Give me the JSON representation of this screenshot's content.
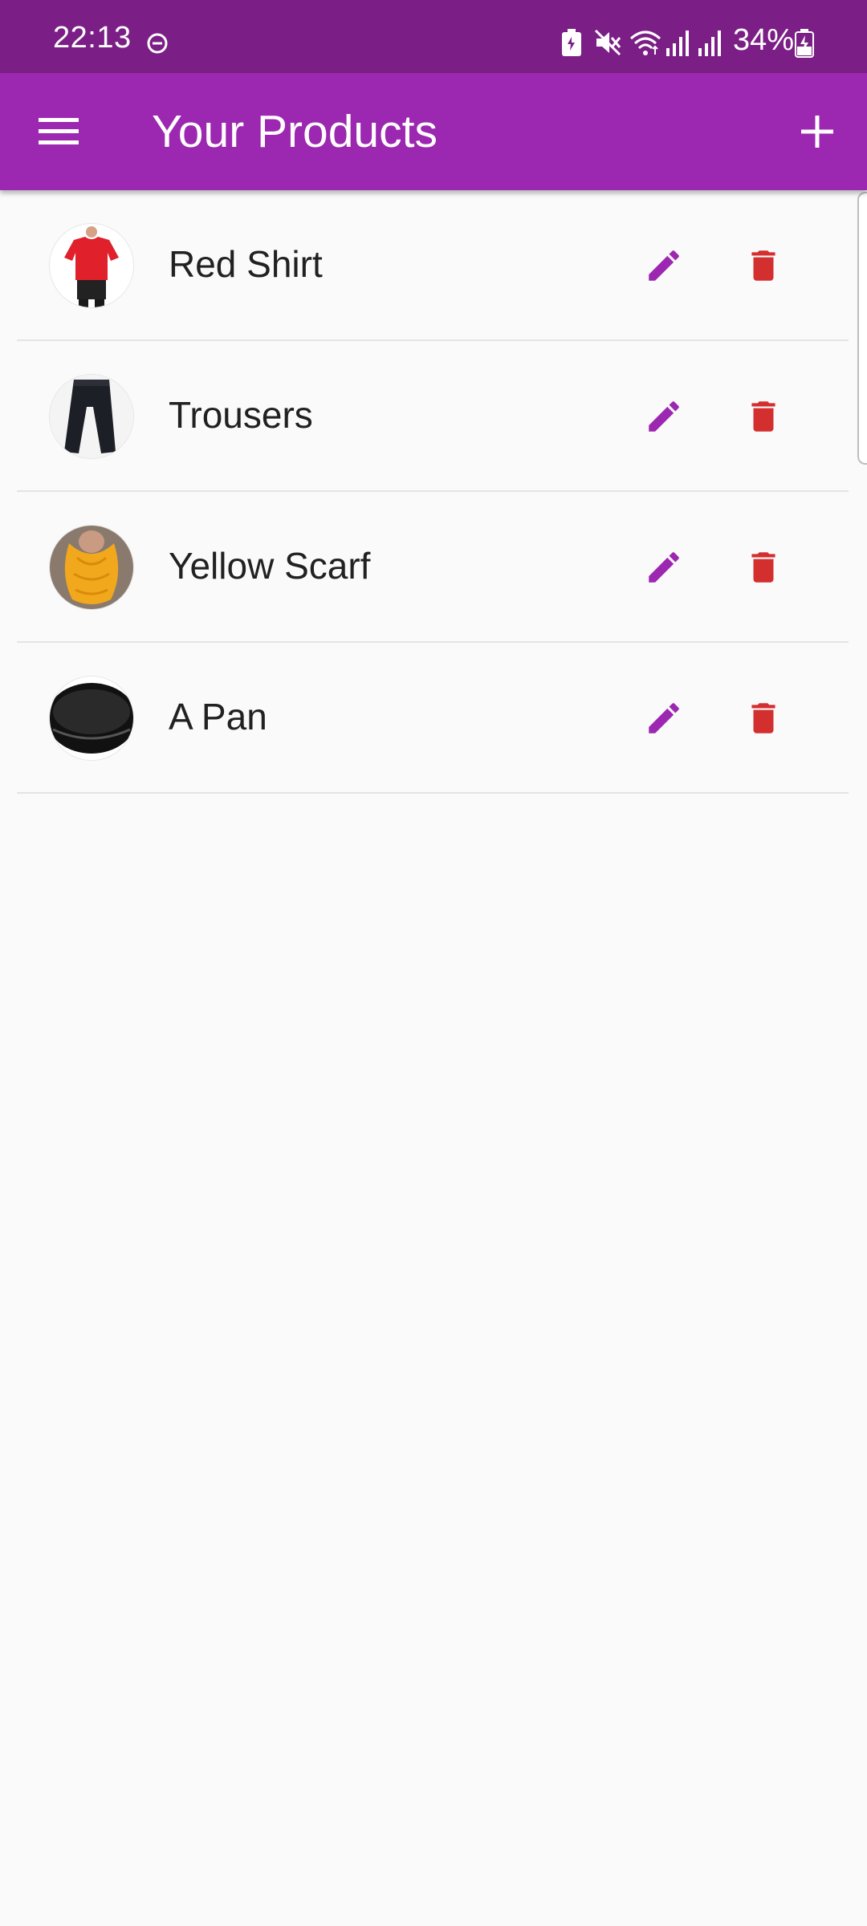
{
  "status_bar": {
    "time": "22:13",
    "battery": "34%",
    "icons": [
      "do-not-disturb-icon",
      "battery-saver-icon",
      "mute-icon",
      "wifi-icon",
      "signal-icon",
      "signal-icon",
      "battery-charging-icon"
    ]
  },
  "app_bar": {
    "title": "Your Products",
    "menu_icon": "menu-icon",
    "add_icon": "add-icon",
    "color": "#9C27B0"
  },
  "products": [
    {
      "title": "Red Shirt",
      "thumbnail": "red-shirt"
    },
    {
      "title": "Trousers",
      "thumbnail": "trousers"
    },
    {
      "title": "Yellow Scarf",
      "thumbnail": "yellow-scarf"
    },
    {
      "title": "A Pan",
      "thumbnail": "pan"
    }
  ],
  "colors": {
    "accent": "#9C27B0",
    "status_bar": "#7B1F86",
    "delete": "#D32F2F",
    "background": "#FAFAFA"
  }
}
